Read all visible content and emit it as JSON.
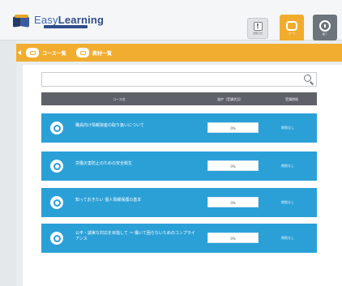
{
  "header": {
    "logo": {
      "brand_easy": "Easy",
      "brand_learning": "Learning"
    },
    "buttons": {
      "info": {
        "icon": "exclamation-icon",
        "glyph": "!",
        "label": "お知らせ"
      },
      "course": {
        "icon": "book-icon",
        "label": "コース"
      },
      "logout": {
        "icon": "power-icon",
        "label": "終了"
      }
    }
  },
  "breadcrumb": {
    "items": [
      {
        "icon": "folder-icon",
        "label": "コース一覧"
      },
      {
        "icon": "folder-icon",
        "label": "教材一覧"
      }
    ]
  },
  "search": {
    "placeholder": ""
  },
  "table": {
    "headers": {
      "name": "コース名",
      "progress": "進捗（受講状況）",
      "date": "受講期限"
    },
    "rows": [
      {
        "title": "職員向け情報資産の取り扱いについて",
        "progress": "0%",
        "progress_value": 0,
        "date": "期限なし"
      },
      {
        "title": "労働災害防止のための安全衛生",
        "progress": "0%",
        "progress_value": 0,
        "date": "期限なし"
      },
      {
        "title": "知っておきたい 個人情報保護の基本",
        "progress": "0%",
        "progress_value": 0,
        "date": "期限なし"
      },
      {
        "title": "公平・誠実な対応を目指して ～ 働いて困らないためのコンプライアンス",
        "progress": "0%",
        "progress_value": 0,
        "date": "期限なし"
      }
    ]
  },
  "colors": {
    "accent": "#f1ad2f",
    "row": "#2ba0d7",
    "table_header": "#5e6167"
  }
}
